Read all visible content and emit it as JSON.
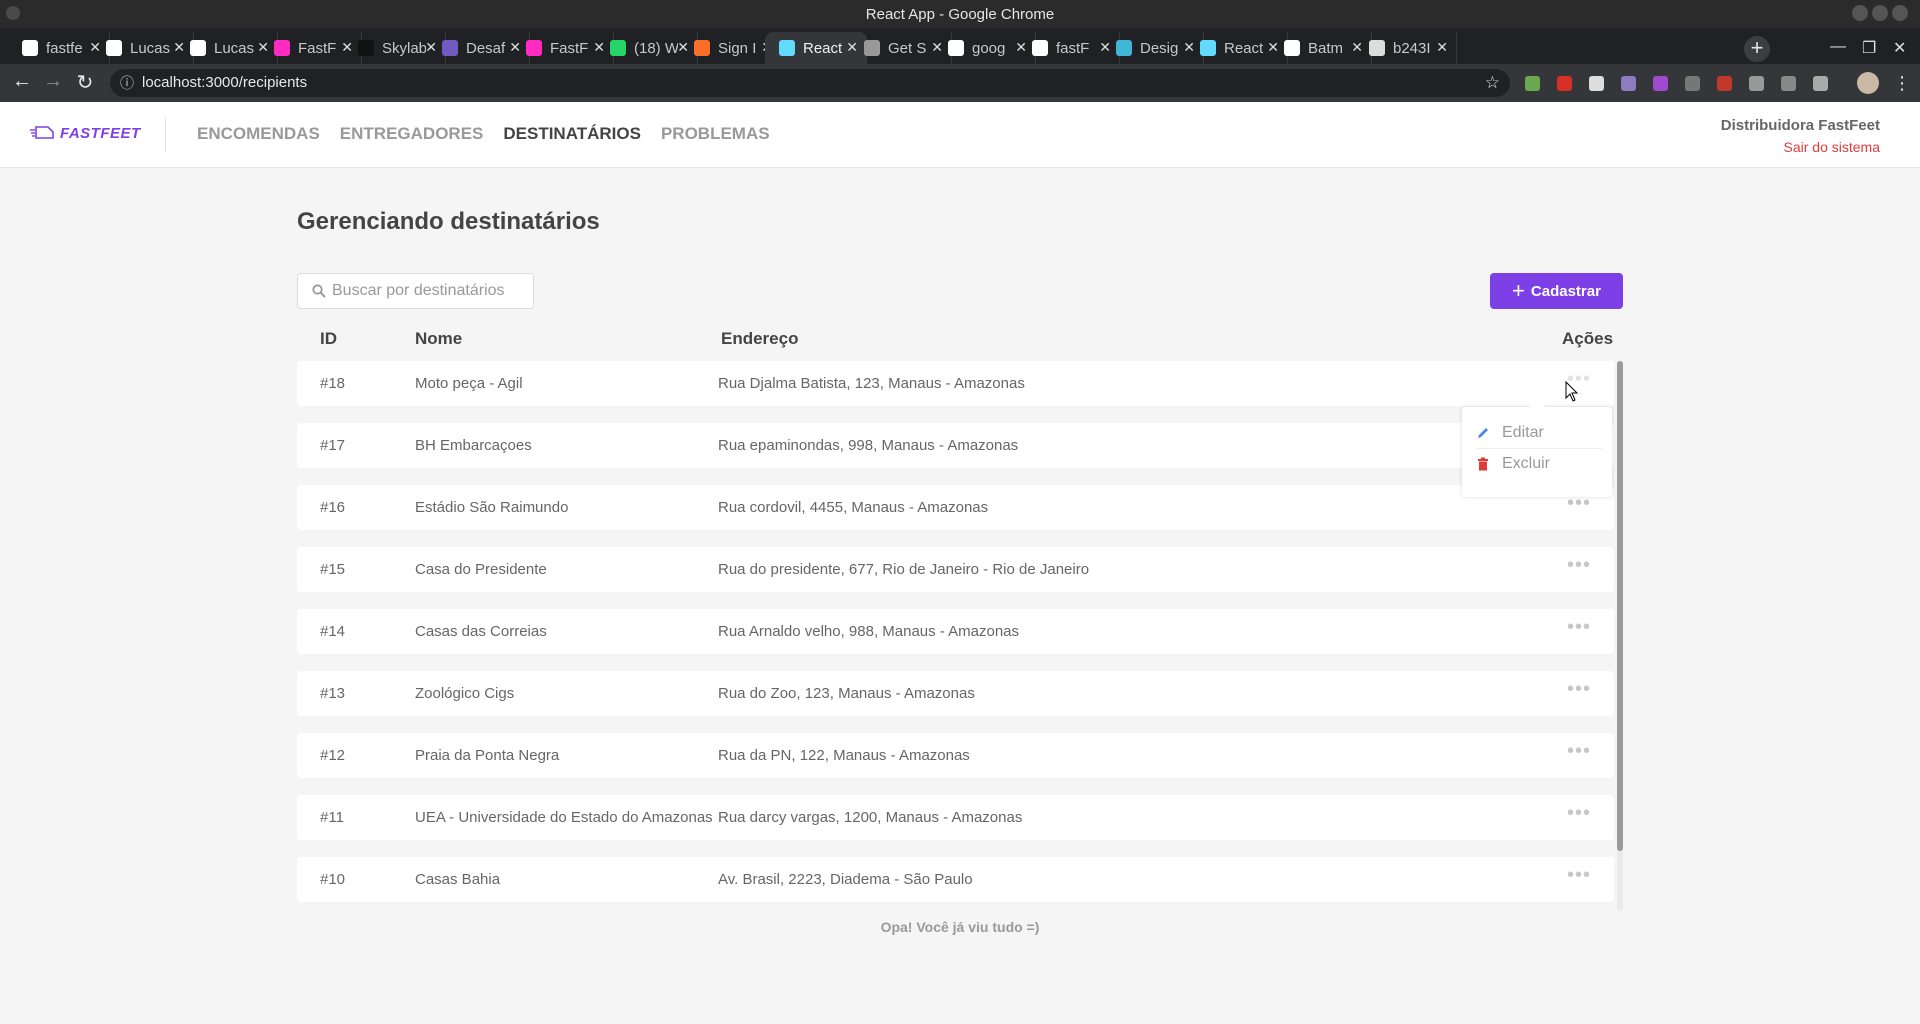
{
  "window": {
    "title": "React App - Google Chrome"
  },
  "tabs": [
    {
      "label": "fastfe",
      "favicon": "github-icon"
    },
    {
      "label": "Lucas",
      "favicon": "github-icon"
    },
    {
      "label": "Lucas",
      "favicon": "github-icon"
    },
    {
      "label": "FastF",
      "favicon": "adobe-xd-icon"
    },
    {
      "label": "Skylab",
      "favicon": "skylab-icon"
    },
    {
      "label": "Desaf",
      "favicon": "rocketseat-icon"
    },
    {
      "label": "FastF",
      "favicon": "adobe-xd-icon"
    },
    {
      "label": "(18) W",
      "favicon": "whatsapp-icon"
    },
    {
      "label": "Sign I",
      "favicon": "gitlab-icon"
    },
    {
      "label": "React",
      "favicon": "react-icon",
      "active": true
    },
    {
      "label": "Get S",
      "favicon": "triangle-icon"
    },
    {
      "label": "goog",
      "favicon": "google-icon"
    },
    {
      "label": "fastF",
      "favicon": "github-icon"
    },
    {
      "label": "Desig",
      "favicon": "design-icon"
    },
    {
      "label": "React",
      "favicon": "react-icon"
    },
    {
      "label": "Batm",
      "favicon": "google-icon"
    },
    {
      "label": "b243I",
      "favicon": "globe-icon"
    }
  ],
  "browser": {
    "url": "localhost:3000/recipients"
  },
  "app": {
    "logo_text": "FASTFEET",
    "nav": [
      {
        "label": "ENCOMENDAS",
        "active": false
      },
      {
        "label": "ENTREGADORES",
        "active": false
      },
      {
        "label": "DESTINATÁRIOS",
        "active": true
      },
      {
        "label": "PROBLEMAS",
        "active": false
      }
    ],
    "user_name": "Distribuidora FastFeet",
    "logout_label": "Sair do sistema",
    "colors": {
      "accent": "#7d40e7",
      "danger": "#de3b3b",
      "edit": "#4d85ee"
    }
  },
  "page": {
    "title": "Gerenciando destinatários",
    "search_placeholder": "Buscar por destinatários",
    "add_button": "Cadastrar",
    "footer_note": "Opa! Você já viu tudo =)"
  },
  "table": {
    "headers": {
      "id": "ID",
      "name": "Nome",
      "address": "Endereço",
      "actions": "Ações"
    },
    "rows": [
      {
        "id": "#18",
        "name": "Moto peça - Agil",
        "address": "Rua Djalma Batista, 123, Manaus - Amazonas"
      },
      {
        "id": "#17",
        "name": "BH Embarcaçoes",
        "address": "Rua epaminondas, 998, Manaus - Amazonas"
      },
      {
        "id": "#16",
        "name": "Estádio São Raimundo",
        "address": "Rua cordovil, 4455, Manaus - Amazonas"
      },
      {
        "id": "#15",
        "name": "Casa do Presidente",
        "address": "Rua do presidente, 677, Rio de Janeiro - Rio de Janeiro"
      },
      {
        "id": "#14",
        "name": "Casas das Correias",
        "address": "Rua Arnaldo velho, 988, Manaus - Amazonas"
      },
      {
        "id": "#13",
        "name": "Zoológico Cigs",
        "address": "Rua do Zoo, 123, Manaus - Amazonas"
      },
      {
        "id": "#12",
        "name": "Praia da Ponta Negra",
        "address": "Rua da PN, 122, Manaus - Amazonas"
      },
      {
        "id": "#11",
        "name": "UEA - Universidade do Estado do Amazonas",
        "address": "Rua darcy vargas, 1200, Manaus - Amazonas"
      },
      {
        "id": "#10",
        "name": "Casas Bahia",
        "address": "Av. Brasil, 2223, Diadema - São Paulo"
      }
    ],
    "actions_glyph": "•••"
  },
  "actions_menu": {
    "edit_label": "Editar",
    "delete_label": "Excluir"
  }
}
